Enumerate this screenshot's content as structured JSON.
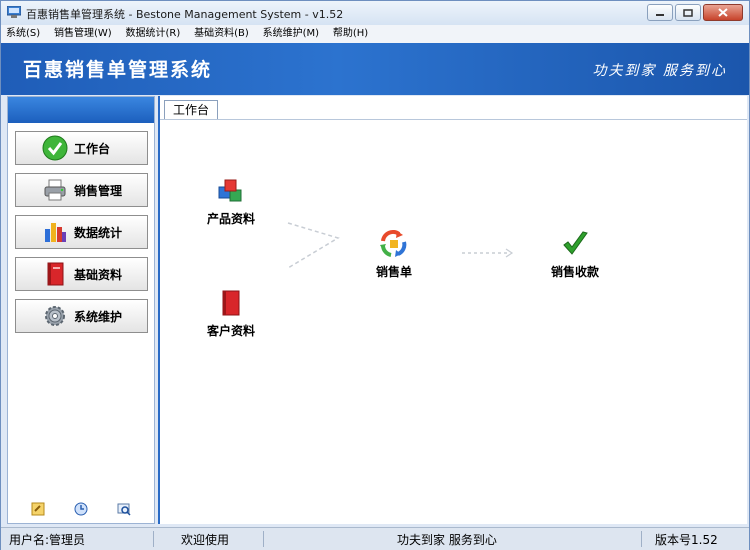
{
  "window": {
    "title": "百惠销售单管理系统 - Bestone Management System - v1.52"
  },
  "menu": [
    {
      "label": "系统(S)"
    },
    {
      "label": "销售管理(W)"
    },
    {
      "label": "数据统计(R)"
    },
    {
      "label": "基础资料(B)"
    },
    {
      "label": "系统维护(M)"
    },
    {
      "label": "帮助(H)"
    }
  ],
  "banner": {
    "title": "百惠销售单管理系统",
    "slogan": "功夫到家 服务到心"
  },
  "sidebar": {
    "items": [
      {
        "label": "工作台",
        "icon": "check-circle-icon"
      },
      {
        "label": "销售管理",
        "icon": "printer-icon"
      },
      {
        "label": "数据统计",
        "icon": "bar-chart-icon"
      },
      {
        "label": "基础资料",
        "icon": "red-book-icon"
      },
      {
        "label": "系统维护",
        "icon": "gear-icon"
      }
    ],
    "tools": [
      {
        "icon": "key-icon"
      },
      {
        "icon": "clock-icon"
      },
      {
        "icon": "search-window-icon"
      }
    ]
  },
  "main": {
    "tab": "工作台",
    "flow": {
      "product": "产品资料",
      "customer": "客户资料",
      "sales_order": "销售单",
      "sales_receipt": "销售收款"
    }
  },
  "status": {
    "user": "用户名:管理员",
    "welcome": "欢迎使用",
    "slogan": "功夫到家 服务到心",
    "version": "版本号1.52"
  },
  "colors": {
    "accent": "#2a6bc6",
    "banner": "#1f5db8"
  }
}
